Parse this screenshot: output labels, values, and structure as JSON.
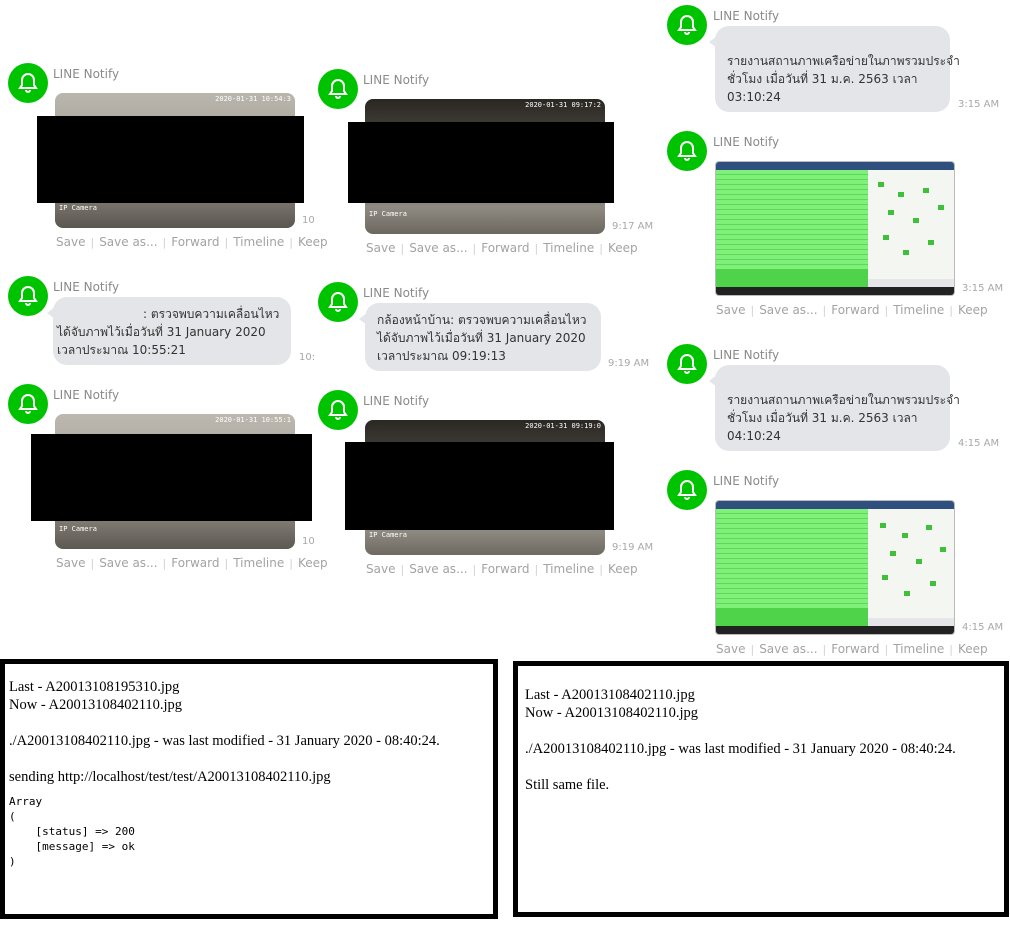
{
  "sender": "LINE Notify",
  "actions": [
    "Save",
    "Save as...",
    "Forward",
    "Timeline",
    "Keep"
  ],
  "col1": {
    "photo1": {
      "stamp": "2020-01-31 10:54:3",
      "cam": "IP Camera",
      "time": "10"
    },
    "text1": {
      "lines": [
        ": ตรวจพบความเคลื่อนไหว",
        "ได้จับภาพไว้เมื่อวันที่ 31 January 2020",
        "เวลาประมาณ 10:55:21"
      ],
      "time": "10:"
    },
    "photo2": {
      "stamp": "2020-01-31 10:55:1",
      "cam": "IP Camera",
      "time": "10"
    }
  },
  "col2": {
    "photo1": {
      "stamp": "2020-01-31 09:17:2",
      "cam": "IP Camera",
      "time": "9:17 AM"
    },
    "text1": {
      "lines": [
        "กล้องหน้าบ้าน: ตรวจพบความเคลื่อนไหว",
        "ได้จับภาพไว้เมื่อวันที่ 31 January 2020",
        "เวลาประมาณ 09:19:13"
      ],
      "time": "9:19 AM"
    },
    "photo2": {
      "stamp": "2020-01-31 09:19:0",
      "cam": "IP Camera",
      "time": "9:19 AM"
    }
  },
  "col3": {
    "text1": {
      "lines": [
        "รายงานสถานภาพเครือข่ายในภาพรวมประจำ",
        "ชั่วโมง เมื่อวันที่ 31 ม.ค. 2563 เวลา",
        "03:10:24"
      ],
      "time": "3:15 AM"
    },
    "shot1": {
      "time": "3:15 AM"
    },
    "text2": {
      "lines": [
        "รายงานสถานภาพเครือข่ายในภาพรวมประจำ",
        "ชั่วโมง เมื่อวันที่ 31 ม.ค. 2563 เวลา",
        "04:10:24"
      ],
      "time": "4:15 AM"
    },
    "shot2": {
      "time": "4:15 AM"
    }
  },
  "panel_left": {
    "last": "Last - A20013108195310.jpg",
    "now": "Now - A20013108402110.jpg",
    "modified": "./A20013108402110.jpg - was last modified - 31 January 2020 - 08:40:24.",
    "sending": "sending http://localhost/test/test/A20013108402110.jpg",
    "array": "Array\n(\n    [status] => 200\n    [message] => ok\n)"
  },
  "panel_right": {
    "last": "Last - A20013108402110.jpg",
    "now": "Now - A20013108402110.jpg",
    "modified": "./A20013108402110.jpg - was last modified - 31 January 2020 - 08:40:24.",
    "status": "Still same file."
  }
}
